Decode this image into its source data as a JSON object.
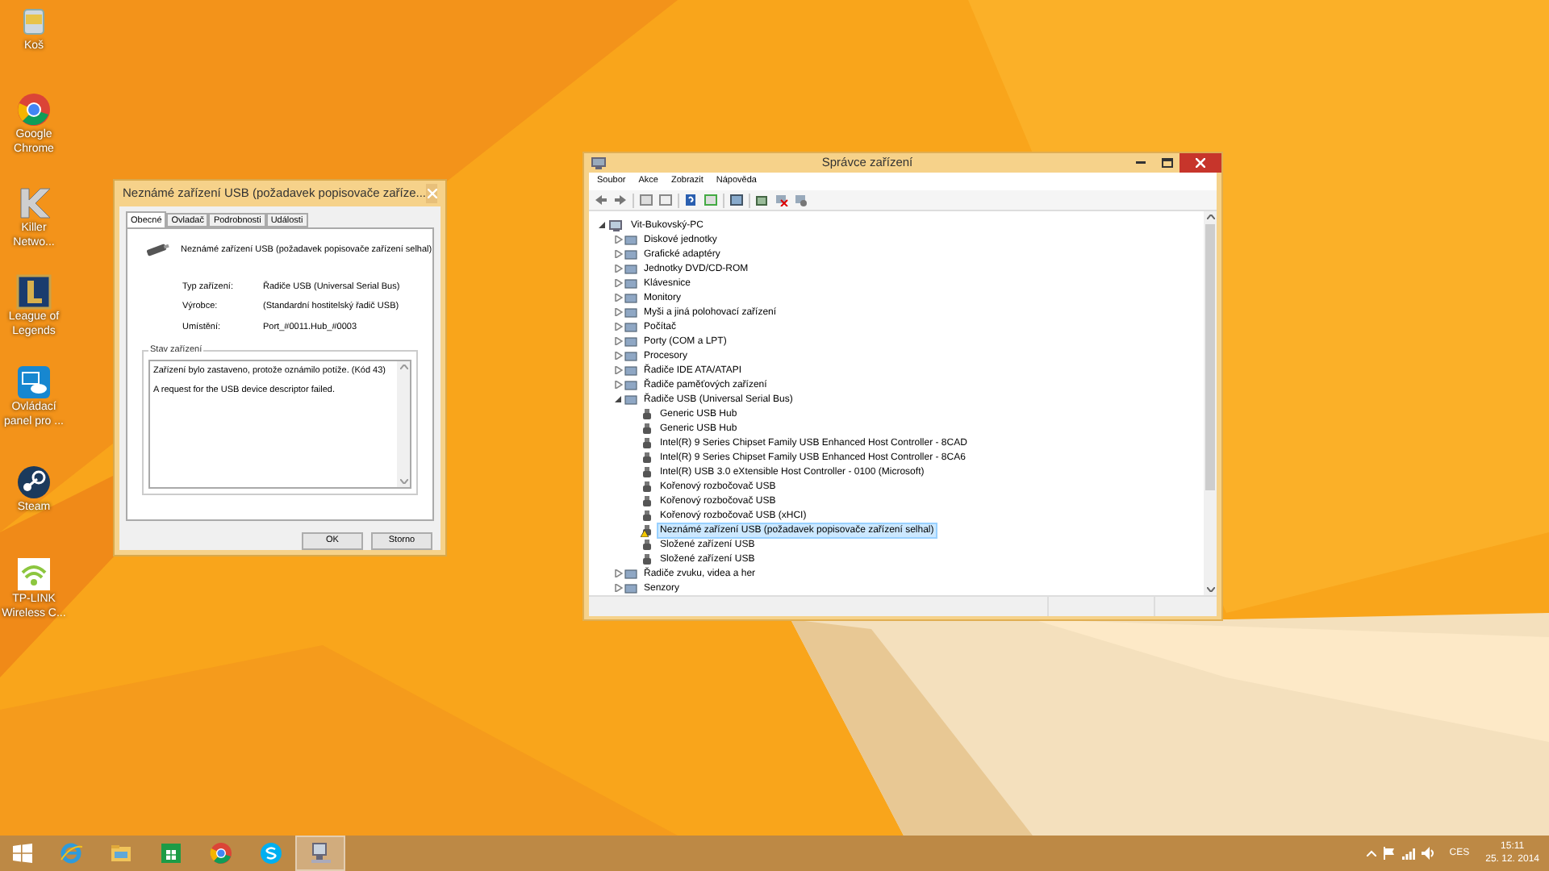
{
  "desktop_icons": [
    {
      "label": "Koš",
      "kind": "bin"
    },
    {
      "label": "Google Chrome",
      "kind": "chrome"
    },
    {
      "label": "Killer Netwo...",
      "kind": "killer"
    },
    {
      "label": "League of Legends",
      "kind": "league"
    },
    {
      "label": "Ovládací panel pro ...",
      "kind": "intel"
    },
    {
      "label": "Steam",
      "kind": "steam"
    },
    {
      "label": "TP-LINK Wireless C...",
      "kind": "wifi"
    }
  ],
  "properties_window": {
    "title": "Neznámé zařízení USB (požadavek popisovače zaříze...",
    "tabs": [
      {
        "label": "Obecné",
        "selected": true
      },
      {
        "label": "Ovladač",
        "selected": false
      },
      {
        "label": "Podrobnosti",
        "selected": false
      },
      {
        "label": "Události",
        "selected": false
      }
    ],
    "device_name": "Neznámé zařízení USB (požadavek popisovače zařízení selhal)",
    "fields": [
      {
        "label": "Typ zařízení:",
        "value": "Řadiče USB (Universal Serial Bus)"
      },
      {
        "label": "Výrobce:",
        "value": "(Standardní hostitelský řadič USB)"
      },
      {
        "label": "Umístění:",
        "value": "Port_#0011.Hub_#0003"
      }
    ],
    "status_group": "Stav zařízení",
    "status_lines": [
      "Zařízení bylo zastaveno, protože oznámilo potíže. (Kód 43)",
      "A request for the USB device descriptor failed."
    ],
    "buttons": [
      "OK",
      "Storno"
    ]
  },
  "device_manager": {
    "title": "Správce zařízení",
    "menu": [
      "Soubor",
      "Akce",
      "Zobrazit",
      "Nápověda"
    ],
    "tree": {
      "label": "Vit-Bukovský-PC",
      "expanded": true,
      "selected": false,
      "children": [
        {
          "label": "Diskové jednotky",
          "expanded": false,
          "selected": false
        },
        {
          "label": "Grafické adaptéry",
          "expanded": false,
          "selected": false
        },
        {
          "label": "Jednotky DVD/CD-ROM",
          "expanded": false,
          "selected": false
        },
        {
          "label": "Klávesnice",
          "expanded": false,
          "selected": false
        },
        {
          "label": "Monitory",
          "expanded": false,
          "selected": false
        },
        {
          "label": "Myši a jiná polohovací zařízení",
          "expanded": false,
          "selected": false
        },
        {
          "label": "Počítač",
          "expanded": false,
          "selected": false
        },
        {
          "label": "Porty (COM a LPT)",
          "expanded": false,
          "selected": false
        },
        {
          "label": "Procesory",
          "expanded": false,
          "selected": false
        },
        {
          "label": "Řadiče IDE ATA/ATAPI",
          "expanded": false,
          "selected": false
        },
        {
          "label": "Řadiče paměťových zařízení",
          "expanded": false,
          "selected": false
        },
        {
          "label": "Řadiče USB (Universal Serial Bus)",
          "expanded": true,
          "selected": false,
          "children": [
            {
              "label": "Generic USB Hub",
              "selected": false,
              "warning": false
            },
            {
              "label": "Generic USB Hub",
              "selected": false,
              "warning": false
            },
            {
              "label": "Intel(R) 9 Series Chipset Family USB Enhanced Host Controller - 8CAD",
              "selected": false,
              "warning": false
            },
            {
              "label": "Intel(R) 9 Series Chipset Family USB Enhanced Host Controller - 8CA6",
              "selected": false,
              "warning": false
            },
            {
              "label": "Intel(R) USB 3.0 eXtensible Host Controller - 0100 (Microsoft)",
              "selected": false,
              "warning": false
            },
            {
              "label": "Kořenový rozbočovač USB",
              "selected": false,
              "warning": false
            },
            {
              "label": "Kořenový rozbočovač USB",
              "selected": false,
              "warning": false
            },
            {
              "label": "Kořenový rozbočovač USB (xHCI)",
              "selected": false,
              "warning": false
            },
            {
              "label": "Neznámé zařízení USB (požadavek popisovače zařízení selhal)",
              "selected": true,
              "warning": true
            },
            {
              "label": "Složené zařízení USB",
              "selected": false,
              "warning": false
            },
            {
              "label": "Složené zařízení USB",
              "selected": false,
              "warning": false
            }
          ]
        },
        {
          "label": "Řadiče zvuku, videa a her",
          "expanded": false,
          "selected": false
        },
        {
          "label": "Senzory",
          "expanded": false,
          "selected": false
        }
      ]
    }
  },
  "taskbar": {
    "apps": [
      {
        "kind": "ie",
        "selected": false
      },
      {
        "kind": "explorer",
        "selected": false
      },
      {
        "kind": "store",
        "selected": false
      },
      {
        "kind": "chrome",
        "selected": false
      },
      {
        "kind": "skype",
        "selected": false
      },
      {
        "kind": "devmgr",
        "selected": true
      }
    ],
    "language": "CES",
    "time": "15:11",
    "date": "25. 12. 2014"
  }
}
